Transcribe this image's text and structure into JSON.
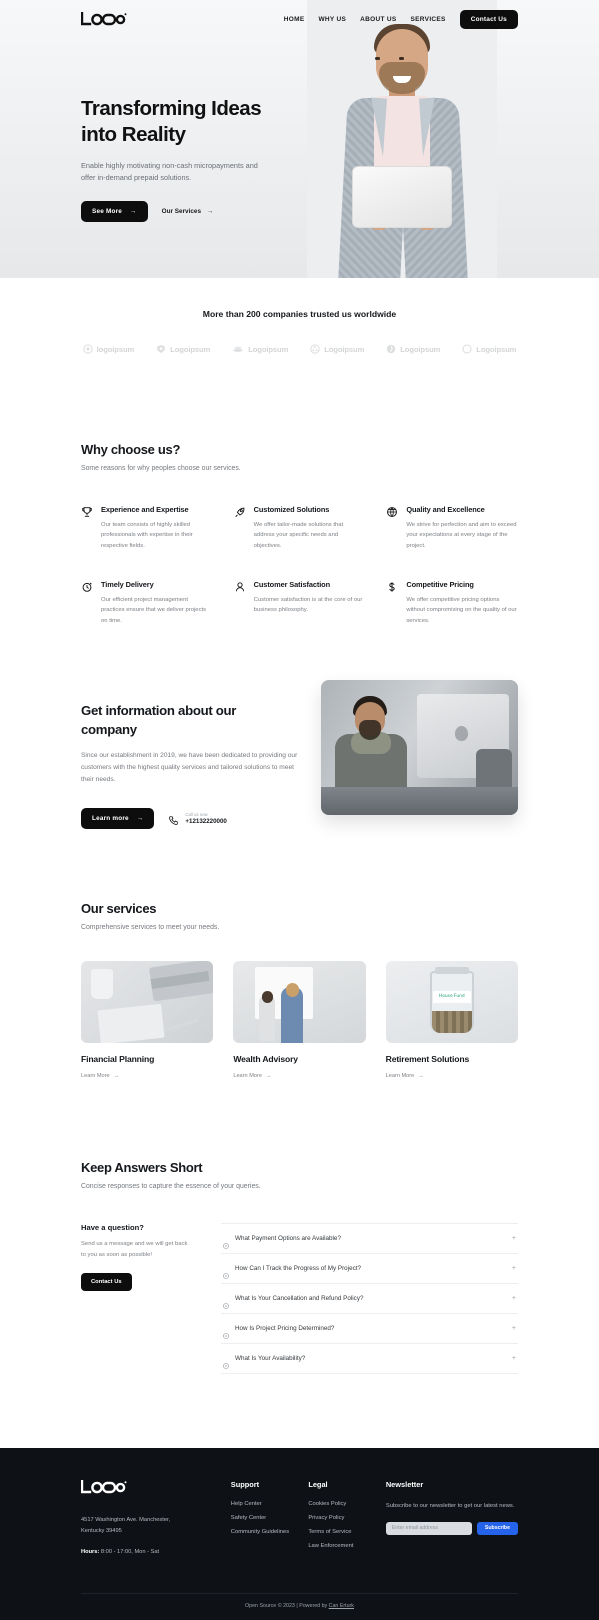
{
  "nav": {
    "logo_alt": "LOGO",
    "links": [
      {
        "label": "HOME"
      },
      {
        "label": "WHY US"
      },
      {
        "label": "ABOUT US"
      },
      {
        "label": "SERVICES"
      }
    ],
    "cta": "Contact Us"
  },
  "hero": {
    "title_line1": "Transforming Ideas",
    "title_line2": "into Reality",
    "subtitle": "Enable highly motivating non-cash micropayments and offer in-demand prepaid solutions.",
    "primary_btn": "See More",
    "secondary_btn": "Our Services",
    "arrow": "→"
  },
  "trusted": {
    "title": "More than 200 companies trusted us worldwide",
    "logos": [
      {
        "label": "logoipsum",
        "icon": "circle-target-icon"
      },
      {
        "label": "Logoipsum",
        "icon": "shield-icon"
      },
      {
        "label": "Logoipsum",
        "icon": "waves-icon"
      },
      {
        "label": "Logoipsum",
        "icon": "flower-icon"
      },
      {
        "label": "Logoipsum",
        "icon": "spiral-icon"
      },
      {
        "label": "Logoipsum",
        "icon": "ring-icon"
      }
    ]
  },
  "why": {
    "title": "Why choose us?",
    "subtitle": "Some reasons for why peoples choose our services.",
    "features": [
      {
        "icon": "trophy-icon",
        "title": "Experience and Expertise",
        "text": "Our team consists of highly skilled professionals with expertise in their respective fields."
      },
      {
        "icon": "rocket-icon",
        "title": "Customized Solutions",
        "text": "We offer tailor-made solutions that address your specific needs and objectives."
      },
      {
        "icon": "globe-icon",
        "title": "Quality and Excellence",
        "text": "We strive for perfection and aim to exceed your expectations at every stage of the project."
      },
      {
        "icon": "clock-icon",
        "title": "Timely Delivery",
        "text": "Our efficient project management practices ensure that we deliver projects on time."
      },
      {
        "icon": "user-icon",
        "title": "Customer Satisfaction",
        "text": "Customer satisfaction is at the core of our business philosophy."
      },
      {
        "icon": "dollar-icon",
        "title": "Competitive Pricing",
        "text": "We offer competitive pricing options without compromising on the quality of our services."
      }
    ]
  },
  "about": {
    "title_line1": "Get information about our",
    "title_line2": "company",
    "text": "Since our establishment in 2019, we have been dedicated to providing our customers with the highest quality services and tailored solutions to meet their needs.",
    "button": "Learn more",
    "arrow": "→",
    "phone_label": "Call us now",
    "phone_number": "+12132220000"
  },
  "services": {
    "title": "Our services",
    "subtitle": "Comprehensive services to meet your needs.",
    "items": [
      {
        "name": "Financial Planning",
        "link": "Learn More",
        "image_alt": "desk-with-laptop-and-notebook"
      },
      {
        "name": "Wealth Advisory",
        "link": "Learn More",
        "image_alt": "two-colleagues-at-whiteboard"
      },
      {
        "name": "Retirement Solutions",
        "link": "Learn More",
        "image_alt": "coin-jar-house-fund",
        "jar_label": "House Fund"
      }
    ],
    "arrow": "→"
  },
  "faq": {
    "title": "Keep Answers Short",
    "subtitle": "Concise responses to capture the essence of your queries.",
    "side_title": "Have a question?",
    "side_text": "Send us a message and we will get back to you as soon as possible!",
    "side_button": "Contact Us",
    "plus": "+",
    "items": [
      {
        "question": "What Payment Options are Available?"
      },
      {
        "question": "How Can I Track the Progress of My Project?"
      },
      {
        "question": "What Is Your Cancellation and Refund Policy?"
      },
      {
        "question": "How Is Project Pricing Determined?"
      },
      {
        "question": "What Is Your Availability?"
      }
    ]
  },
  "footer": {
    "logo_alt": "LOGO",
    "address_line1": "4517 Washington Ave. Manchester,",
    "address_line2": "Kentucky 39495",
    "hours_label": "Hours:",
    "hours_value": "8:00 - 17:00, Mon - Sat",
    "columns": [
      {
        "title": "Support",
        "links": [
          {
            "label": "Help Center"
          },
          {
            "label": "Safety Center"
          },
          {
            "label": "Community Guidelines"
          }
        ]
      },
      {
        "title": "Legal",
        "links": [
          {
            "label": "Cookies Policy"
          },
          {
            "label": "Privacy Policy"
          },
          {
            "label": "Terms of Service"
          },
          {
            "label": "Law Enforcement"
          }
        ]
      }
    ],
    "newsletter": {
      "title": "Newsletter",
      "text": "Subscribe to our newsletter to get our latest news.",
      "placeholder": "Enter email address",
      "input_value": "",
      "button": "Subscribe"
    },
    "bottom_prefix": "Open Source © 2023 | Powered by ",
    "bottom_link": "Can Erturk"
  },
  "colors": {
    "accent_dark": "#0d0d0d",
    "subscribe_blue": "#2563eb",
    "footer_bg": "#0e1116",
    "muted_text": "#7c8085"
  }
}
